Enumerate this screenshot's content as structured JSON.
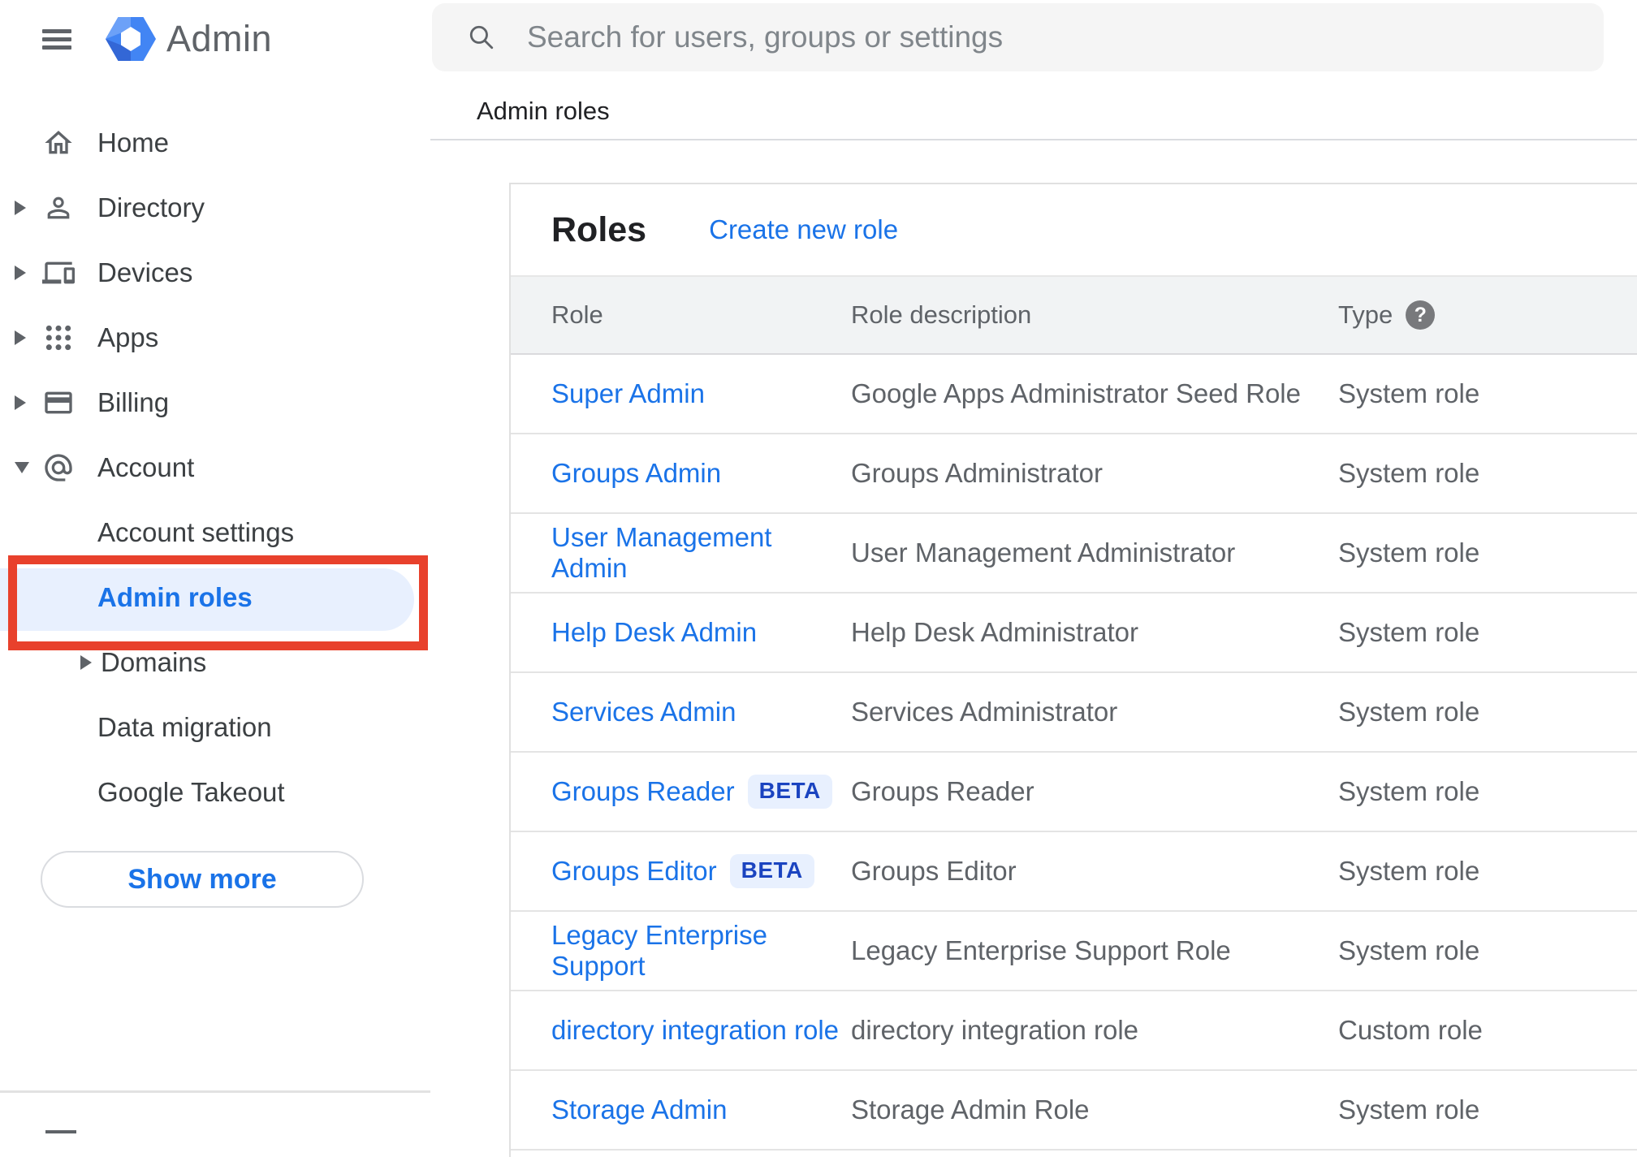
{
  "app": {
    "name": "Admin",
    "logo_icon": "admin-hexagon-logo"
  },
  "search": {
    "placeholder": "Search for users, groups or settings",
    "icon": "search-icon"
  },
  "page": {
    "title": "Admin roles"
  },
  "sidebar": {
    "items": [
      {
        "label": "Home",
        "icon": "home-icon",
        "expandable": false
      },
      {
        "label": "Directory",
        "icon": "person-icon",
        "expandable": true,
        "state": "collapsed"
      },
      {
        "label": "Devices",
        "icon": "devices-icon",
        "expandable": true,
        "state": "collapsed"
      },
      {
        "label": "Apps",
        "icon": "apps-grid-icon",
        "expandable": true,
        "state": "collapsed"
      },
      {
        "label": "Billing",
        "icon": "credit-card-icon",
        "expandable": true,
        "state": "collapsed"
      },
      {
        "label": "Account",
        "icon": "at-sign-icon",
        "expandable": true,
        "state": "expanded"
      },
      {
        "label": "Account settings",
        "level": "sub"
      },
      {
        "label": "Admin roles",
        "level": "sub",
        "active": true
      },
      {
        "label": "Domains",
        "level": "sub",
        "expandable": true,
        "state": "collapsed"
      },
      {
        "label": "Data migration",
        "level": "sub"
      },
      {
        "label": "Google Takeout",
        "level": "sub"
      }
    ],
    "show_more_label": "Show more"
  },
  "roles_card": {
    "title": "Roles",
    "create_link": "Create new role",
    "columns": {
      "role": "Role",
      "description": "Role description",
      "type": "Type"
    },
    "type_help_icon": "help-icon",
    "rows": [
      {
        "role": "Super Admin",
        "beta": "",
        "description": "Google Apps Administrator Seed Role",
        "type": "System role"
      },
      {
        "role": "Groups Admin",
        "beta": "",
        "description": "Groups Administrator",
        "type": "System role"
      },
      {
        "role": "User Management Admin",
        "beta": "",
        "description": "User Management Administrator",
        "type": "System role"
      },
      {
        "role": "Help Desk Admin",
        "beta": "",
        "description": "Help Desk Administrator",
        "type": "System role"
      },
      {
        "role": "Services Admin",
        "beta": "",
        "description": "Services Administrator",
        "type": "System role"
      },
      {
        "role": "Groups Reader",
        "beta": "BETA",
        "description": "Groups Reader",
        "type": "System role"
      },
      {
        "role": "Groups Editor",
        "beta": "BETA",
        "description": "Groups Editor",
        "type": "System role"
      },
      {
        "role": "Legacy Enterprise Support",
        "beta": "",
        "description": "Legacy Enterprise Support Role",
        "type": "System role"
      },
      {
        "role": "directory integration role",
        "beta": "",
        "description": "directory integration role",
        "type": "Custom role"
      },
      {
        "role": "Storage Admin",
        "beta": "",
        "description": "Storage Admin Role",
        "type": "System role"
      }
    ]
  },
  "annotation": {
    "shape": "red-rectangle-highlight",
    "target": "Admin roles sidebar item",
    "color": "#e8412c"
  },
  "colors": {
    "accent_blue": "#1a73e8",
    "active_item_bg": "#e8f0fe",
    "beta_text": "#1b44c0",
    "beta_bg": "#e8f0fe",
    "annotation_red": "#e8412c",
    "header_row_bg": "#f1f3f4"
  }
}
